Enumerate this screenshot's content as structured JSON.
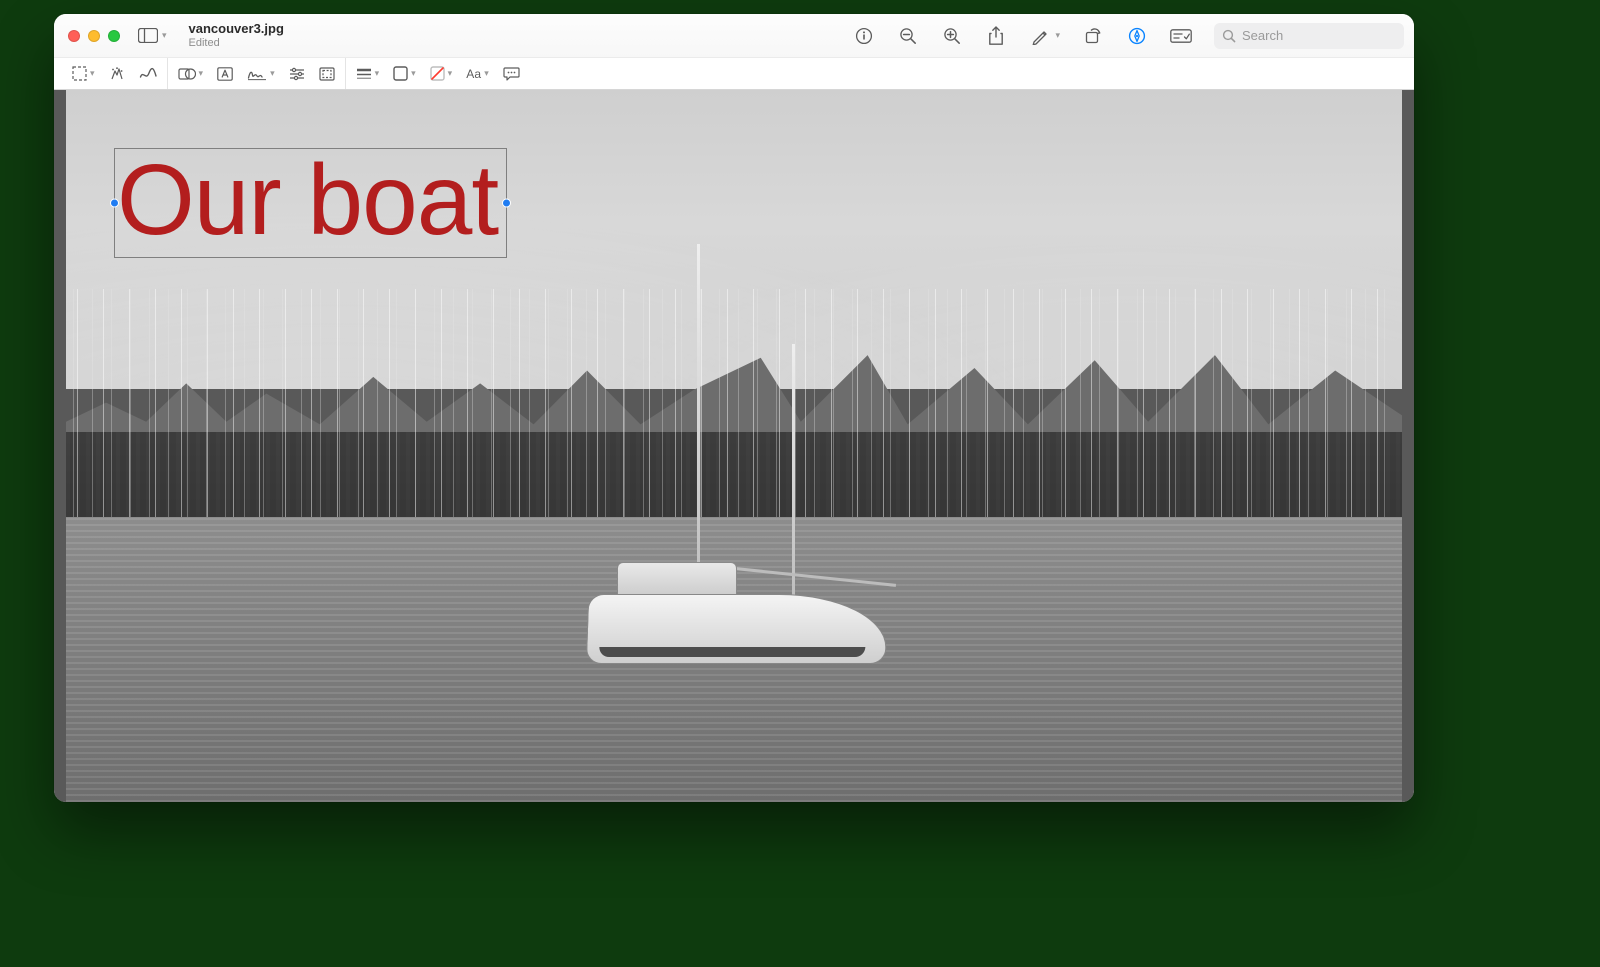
{
  "window": {
    "filename": "vancouver3.jpg",
    "status": "Edited",
    "traffic_lights": {
      "close": "close",
      "minimize": "minimize",
      "zoom": "zoom"
    }
  },
  "toolbar": {
    "sidebar_button": "Sidebar",
    "info_tooltip": "Info",
    "zoom_out_tooltip": "Zoom Out",
    "zoom_in_tooltip": "Zoom In",
    "share_tooltip": "Share",
    "markup_tooltip": "Markup",
    "rotate_tooltip": "Rotate",
    "edit_tooltip": "Edit",
    "form_fill_tooltip": "Form Filling",
    "search": {
      "placeholder": "Search"
    }
  },
  "markup": {
    "selection": "Selection",
    "instant_alpha": "Instant Alpha",
    "draw": "Sketch",
    "shapes": "Shapes",
    "text": "Text",
    "sign": "Sign",
    "adjust_color": "Adjust Color",
    "crop": "Crop",
    "border_style": "Shape Style",
    "border_color": "Border Color",
    "fill_color": "Fill Color",
    "font_label": "Aa",
    "font_tooltip": "Text Style",
    "annotate": "Annotate"
  },
  "canvas": {
    "text_annotation": {
      "value": "Our boat",
      "color": "#b31e1e"
    }
  }
}
